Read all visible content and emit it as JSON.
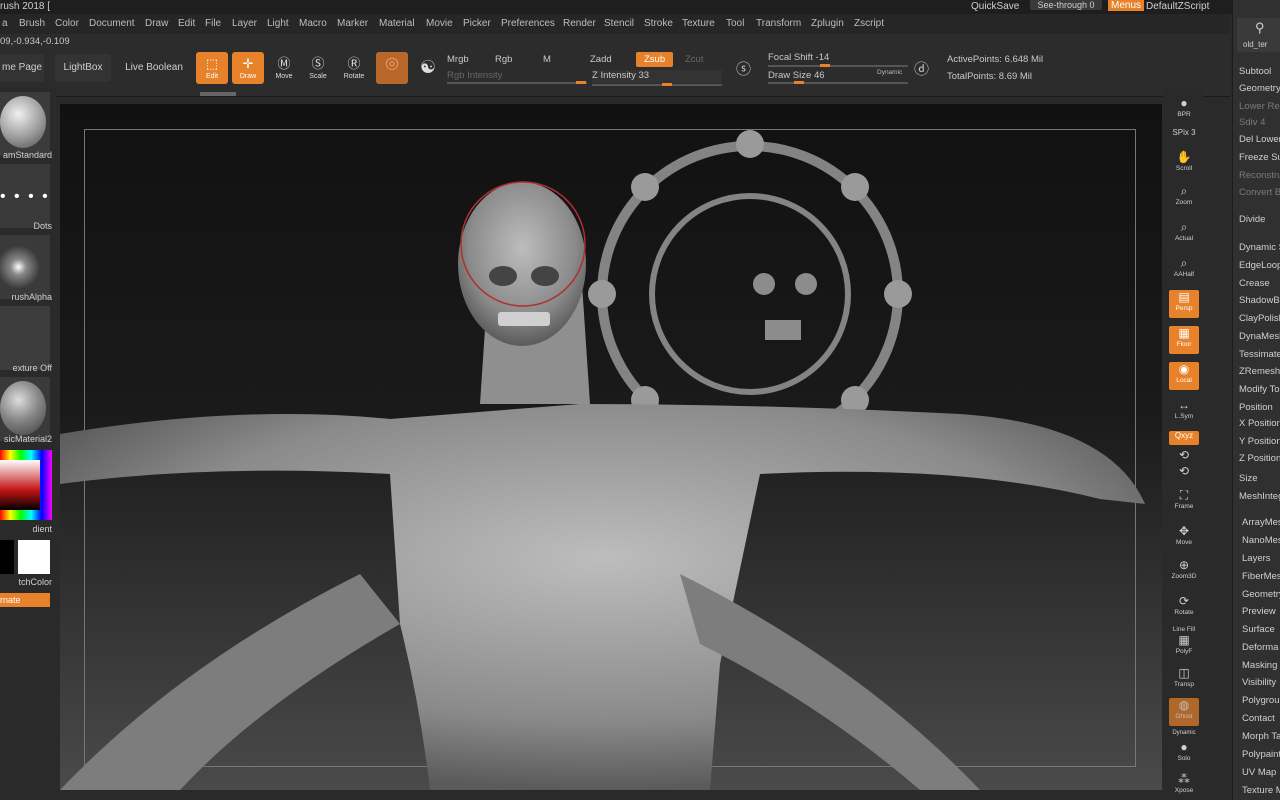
{
  "titlebar": {
    "title": "rush 2018 [",
    "quicksave": "QuickSave",
    "seethrough_label": "See-through",
    "seethrough_value": "0",
    "menus_label": "Menus",
    "script_label": "DefaultZScript"
  },
  "menu": [
    "a",
    "Brush",
    "Color",
    "Document",
    "Draw",
    "Edit",
    "File",
    "Layer",
    "Light",
    "Macro",
    "Marker",
    "Material",
    "Movie",
    "Picker",
    "Preferences",
    "Render",
    "Stencil",
    "Stroke",
    "Texture",
    "Tool",
    "Transform",
    "Zplugin",
    "Zscript"
  ],
  "coords": "09,-0.934,-0.109",
  "shelf": {
    "home_page": "me Page",
    "lightbox": "LightBox",
    "live_boolean": "Live Boolean",
    "tools": {
      "edit": "Edit",
      "draw": "Draw",
      "move": "Move",
      "scale": "Scale",
      "rotate": "Rotate"
    },
    "mrgb": "Mrgb",
    "rgb": "Rgb",
    "m": "M",
    "rgb_intensity": "Rgb Intensity",
    "zadd": "Zadd",
    "zsub": "Zsub",
    "zcut": "Zcut",
    "z_intensity_label": "Z Intensity",
    "z_intensity": 33,
    "focal_shift_label": "Focal Shift",
    "focal_shift": -14,
    "draw_size_label": "Draw Size",
    "draw_size": 46,
    "dynamic": "Dynamic",
    "active_points_label": "ActivePoints:",
    "active_points": "6.648 Mil",
    "total_points_label": "TotalPoints:",
    "total_points": "8.69 Mil"
  },
  "left": {
    "brush": "amStandard",
    "stroke": "Dots",
    "alpha": "rushAlpha",
    "texture": "exture Off",
    "material": "sicMaterial2",
    "gradient": "dient",
    "switch_color": "tchColor",
    "alternate": "rnate"
  },
  "right": {
    "bpr": "BPR",
    "spix_label": "SPix",
    "spix": "3",
    "scroll": "Scroll",
    "zoom": "Zoom",
    "actual": "Actual",
    "aahalf": "AAHalf",
    "persp": "Persp",
    "floor": "Floor",
    "local": "Local",
    "lsym": "L.Sym",
    "xyz": "Qxyz",
    "frame": "Frame",
    "move": "Move",
    "zoom3d": "Zoom3D",
    "rotate": "Rotate",
    "line_fill": "Line Fill",
    "polyf": "PolyF",
    "transp": "Transp",
    "ghost": "Ghost",
    "dynamic": "Dynamic",
    "solo": "Solo",
    "xpose": "Xpose"
  },
  "tray": {
    "tool_name": "old_ter",
    "items": [
      "Subtool",
      "Geometry",
      "Lower Res",
      "Sdiv 4",
      "Del Lower",
      "Freeze Su",
      "Reconstru",
      "Convert B",
      "Divide",
      "Dynamic S",
      "EdgeLoop",
      "Crease",
      "ShadowBo",
      "ClayPolish",
      "DynaMesh",
      "Tessimate",
      "ZRemesh",
      "Modify To",
      "Position",
      "X Position",
      "Y Position",
      "Z Position",
      "Size",
      "MeshInteg",
      "ArrayMes",
      "NanoMes",
      "Layers",
      "FiberMes",
      "Geometry",
      "Preview",
      "Surface",
      "Deforma",
      "Masking",
      "Visibility",
      "Polygrou",
      "Contact",
      "Morph Ta",
      "Polypaint",
      "UV Map",
      "Texture M"
    ]
  },
  "colors": {
    "accent": "#e8822a",
    "panel": "#2a2a2a",
    "canvas_top": "#111111"
  }
}
